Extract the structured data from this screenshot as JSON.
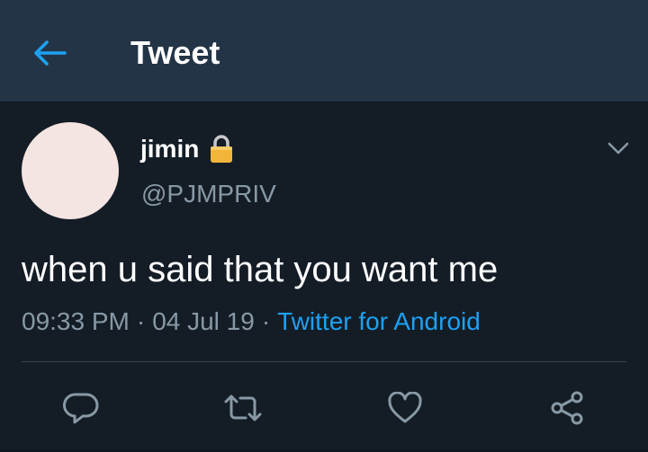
{
  "app_bar": {
    "back_icon": "arrow-left-icon",
    "title": "Tweet"
  },
  "tweet": {
    "author": {
      "display_name": "jimin",
      "protected_icon": "lock-icon",
      "handle": "@PJMPRIV"
    },
    "menu_icon": "chevron-down-icon",
    "text": "when u said that you want me",
    "time": "09:33 PM",
    "separator": "·",
    "date": "04 Jul 19",
    "source": "Twitter for Android"
  },
  "actions": [
    {
      "name": "reply",
      "icon": "reply-icon"
    },
    {
      "name": "retweet",
      "icon": "retweet-icon"
    },
    {
      "name": "like",
      "icon": "heart-icon"
    },
    {
      "name": "share",
      "icon": "share-icon"
    }
  ],
  "colors": {
    "background": "#141d26",
    "app_bar": "#243447",
    "accent": "#1da1f2",
    "secondary_text": "#8899a6",
    "avatar": "#f4e4e2"
  }
}
